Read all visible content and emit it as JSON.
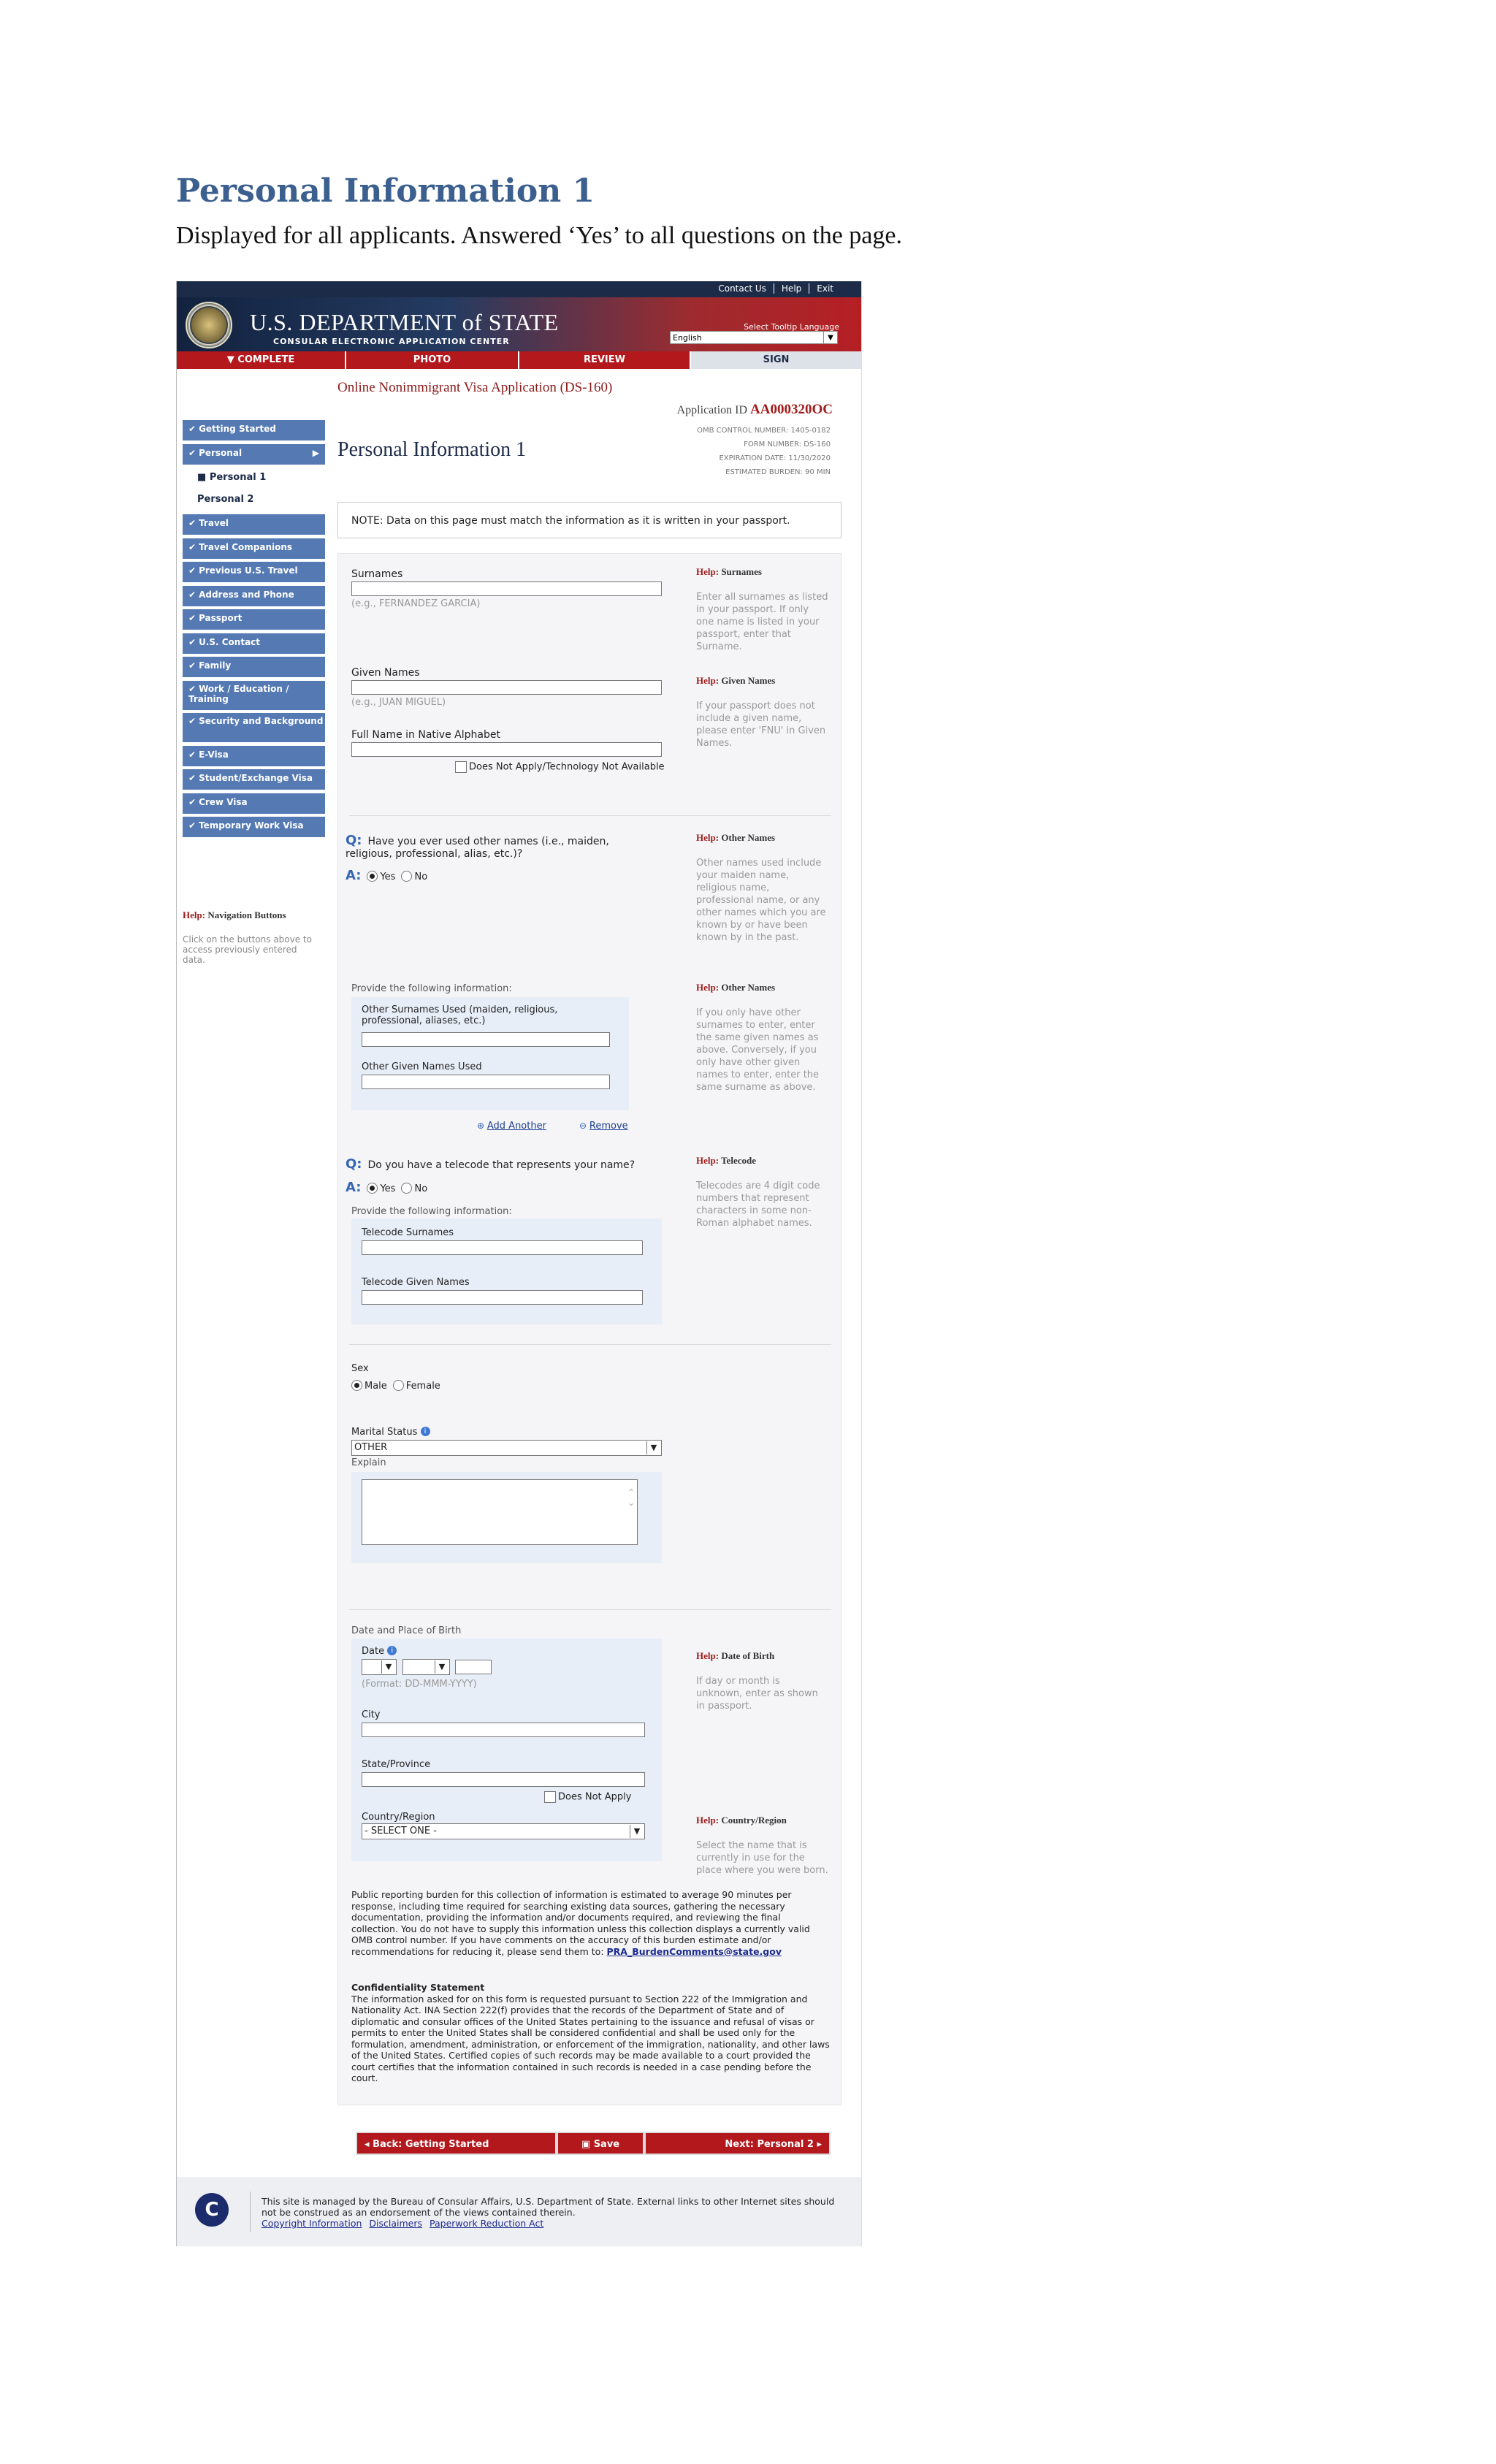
{
  "doc": {
    "title": "Personal Information 1",
    "subtitle": "Displayed for all applicants. Answered ‘Yes’ to all questions on the page."
  },
  "header": {
    "links": [
      "Contact Us",
      "Help",
      "Exit"
    ],
    "dept": "U.S. DEPARTMENT of STATE",
    "center": "CONSULAR ELECTRONIC APPLICATION CENTER",
    "tooltip_label": "Select Tooltip Language",
    "language": "English"
  },
  "steps": [
    "COMPLETE",
    "PHOTO",
    "REVIEW",
    "SIGN"
  ],
  "sidebar": {
    "items": [
      "Getting Started",
      "Personal",
      "Personal 1",
      "Personal 2",
      "Travel",
      "Travel Companions",
      "Previous U.S. Travel",
      "Address and Phone",
      "Passport",
      "U.S. Contact",
      "Family",
      "Work / Education / Training",
      "Security and Background",
      "E-Visa",
      "Student/Exchange Visa",
      "Crew Visa",
      "Temporary Work Visa"
    ],
    "help_prefix": "Help:",
    "help_title": "Navigation Buttons",
    "help_text": "Click on the buttons above to access previously entered data."
  },
  "main": {
    "app_title": "Online Nonimmigrant Visa Application (DS-160)",
    "app_id_label": "Application ID",
    "app_id": "AA000320OC",
    "page_heading": "Personal Information 1",
    "omb": [
      "OMB CONTROL NUMBER:   1405-0182",
      "FORM NUMBER:   DS-160",
      "EXPIRATION DATE:  11/30/2020",
      "ESTIMATED BURDEN:   90 MIN"
    ],
    "note": "NOTE: Data on this page must match the information as it is written in your passport."
  },
  "form": {
    "surnames_label": "Surnames",
    "surnames_hint": "(e.g., FERNANDEZ GARCIA)",
    "given_label": "Given Names",
    "given_hint": "(e.g., JUAN MIGUEL)",
    "native_label": "Full Name in Native Alphabet",
    "native_na": "Does Not Apply/Technology Not Available",
    "q_prefix": "Q:",
    "a_prefix": "A:",
    "yes": "Yes",
    "no": "No",
    "other_names_q": "Have you ever used other names (i.e., maiden, religious, professional, alias, etc.)?",
    "provide": "Provide the following information:",
    "other_surnames_label": "Other Surnames Used (maiden, religious, professional, aliases, etc.)",
    "other_given_label": "Other Given Names Used",
    "add_another": "Add Another",
    "remove": "Remove",
    "telecode_q": "Do you have a telecode that represents your name?",
    "telecode_surnames": "Telecode Surnames",
    "telecode_given": "Telecode Given Names",
    "sex_label": "Sex",
    "male": "Male",
    "female": "Female",
    "marital_label": "Marital Status",
    "marital_value": "OTHER",
    "explain_label": "Explain",
    "dob_section": "Date and Place of Birth",
    "date_label": "Date",
    "date_format": "(Format: DD-MMM-YYYY)",
    "city_label": "City",
    "state_label": "State/Province",
    "state_na": "Does Not Apply",
    "country_label": "Country/Region",
    "country_value": "- SELECT ONE -"
  },
  "help": {
    "prefix": "Help:",
    "surnames_title": "Surnames",
    "surnames_text": "Enter all surnames as listed in your passport. If only one name is listed in your passport, enter that Surname.",
    "given_title": "Given Names",
    "given_text": "If your passport does not include a given name, please enter 'FNU' in Given Names.",
    "other_title": "Other Names",
    "other_text": "Other names used include your maiden name, religious name, professional name, or any other names which you are known by or have been known by in the past.",
    "other2_title": "Other Names",
    "other2_text": "If you only have other surnames to enter, enter the same given names as above. Conversely, if you only have other given names to enter, enter the same surname as above.",
    "telecode_title": "Telecode",
    "telecode_text": "Telecodes are 4 digit code numbers that represent characters in some non-Roman alphabet names.",
    "dob_title": "Date of Birth",
    "dob_text": "If day or month is unknown, enter as shown in passport.",
    "country_title": "Country/Region",
    "country_text": "Select the name that is currently in use for the place where you were born."
  },
  "burden": {
    "text": "Public reporting burden for this collection of information is estimated to average 90 minutes per response, including time required for searching existing data sources, gathering the necessary documentation, providing the information and/or documents required, and reviewing the final collection. You do not have to supply this information unless this collection displays a currently valid OMB control number. If you have comments on the accuracy of this burden estimate and/or recommendations for reducing it, please send them to:",
    "email": "PRA_BurdenComments@state.gov",
    "conf_title": "Confidentiality Statement",
    "conf_text": "The information asked for on this form is requested pursuant to Section 222 of the Immigration and Nationality Act. INA Section 222(f) provides that the records of the Department of State and of diplomatic and consular offices of the United States pertaining to the issuance and refusal of visas or permits to enter the United States shall be considered confidential and shall be used only for the formulation, amendment, administration, or enforcement of the immigration, nationality, and other laws of the United States. Certified copies of such records may be made available to a court provided the court certifies that the information contained in such records is needed in a case pending before the court."
  },
  "nav": {
    "back": "Back: Getting Started",
    "save": "Save",
    "next": "Next: Personal 2"
  },
  "footer": {
    "logo": "C",
    "text": "This site is managed by the Bureau of Consular Affairs, U.S. Department of State. External links to other Internet sites should not be construed as an endorsement of the views contained therein.",
    "links": [
      "Copyright Information",
      "Disclaimers",
      "Paperwork Reduction Act"
    ]
  }
}
